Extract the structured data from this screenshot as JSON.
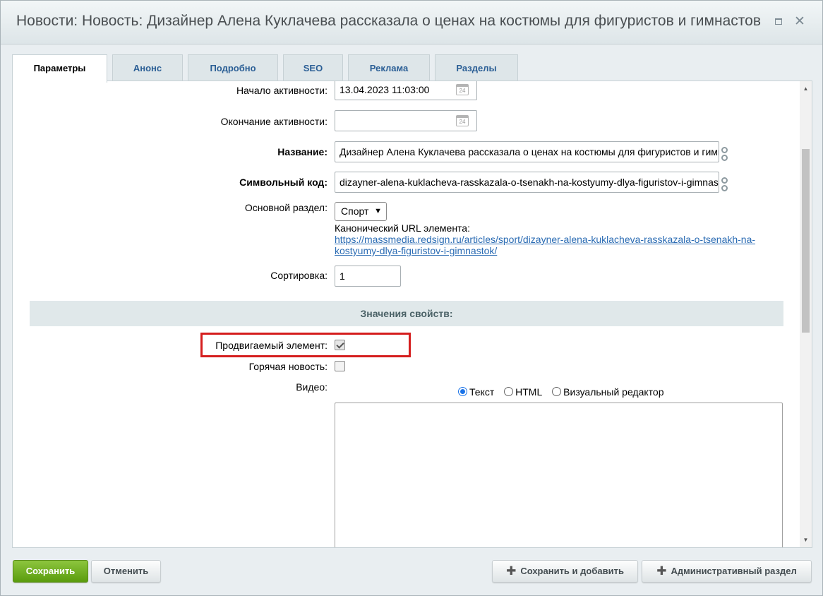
{
  "window": {
    "title": "Новости: Новость: Дизайнер Алена Куклачева рассказала о ценах на костюмы для фигуристов и гимнастов"
  },
  "tabs": [
    {
      "label": "Параметры",
      "active": true
    },
    {
      "label": "Анонс"
    },
    {
      "label": "Подробно"
    },
    {
      "label": "SEO"
    },
    {
      "label": "Реклама"
    },
    {
      "label": "Разделы"
    }
  ],
  "form": {
    "active_from": {
      "label": "Начало активности:",
      "value": "13.04.2023 11:03:00"
    },
    "active_to": {
      "label": "Окончание активности:",
      "value": ""
    },
    "name": {
      "label": "Название:",
      "value": "Дизайнер Алена Куклачева рассказала о ценах на костюмы для фигуристов и гимнастов"
    },
    "code": {
      "label": "Символьный код:",
      "value": "dizayner-alena-kuklacheva-rasskazala-o-tsenakh-na-kostyumy-dlya-figuristov-i-gimnastok"
    },
    "section": {
      "label": "Основной раздел:",
      "value": "Спорт"
    },
    "canonical": {
      "label": "Канонический URL элемента:",
      "url_line1": "https://massmedia.redsign.ru/articles/sport/dizayner-alena-kuklacheva-rasskazala-o-tsenakh-na-",
      "url_line2": "kostyumy-dlya-figuristov-i-gimnastok/"
    },
    "sort": {
      "label": "Сортировка:",
      "value": "1"
    }
  },
  "properties": {
    "heading": "Значения свойств:",
    "promoted": {
      "label": "Продвигаемый элемент:",
      "checked": true
    },
    "hot": {
      "label": "Горячая новость:",
      "checked": false
    },
    "video": {
      "label": "Видео:",
      "modes": [
        "Текст",
        "HTML",
        "Визуальный редактор"
      ],
      "selected": "Текст",
      "value": ""
    }
  },
  "footer": {
    "save": "Сохранить",
    "cancel": "Отменить",
    "save_add": "Сохранить и добавить",
    "admin": "Административный раздел"
  },
  "colors": {
    "accent_green": "#6fb21f",
    "link_blue": "#2a6bb3",
    "highlight_red": "#d51e1e",
    "tab_text": "#2a5e95"
  }
}
